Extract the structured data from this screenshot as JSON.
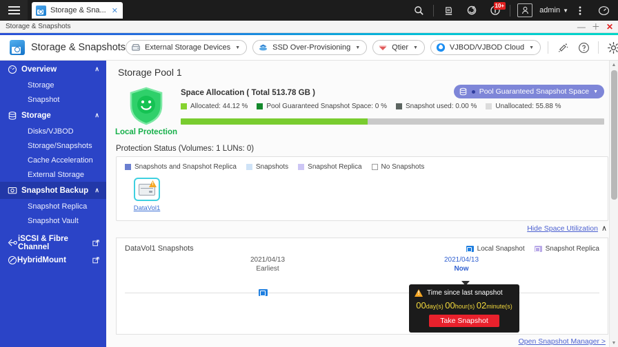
{
  "desktop": {
    "menu_icon": "hamburger-icon",
    "tab": {
      "title": "Storage & Sna...",
      "close": "✕"
    },
    "icons": [
      {
        "name": "search-icon"
      },
      {
        "name": "backup-station-icon"
      },
      {
        "name": "sync-icon"
      },
      {
        "name": "notification-icon",
        "badge": "10+"
      },
      {
        "name": "user-avatar-icon"
      },
      {
        "name": "more-options-icon"
      },
      {
        "name": "resource-monitor-icon"
      }
    ],
    "user": "admin",
    "user_caret": "▼"
  },
  "window": {
    "title": "Storage & Snapshots",
    "minimize": "—",
    "maximize": "＋",
    "close": "✕"
  },
  "toolbar": {
    "app_name": "Storage & Snapshots",
    "buttons": [
      {
        "label": "External Storage Devices",
        "icon": "external-storage-icon",
        "caret": "▼"
      },
      {
        "label": "SSD Over-Provisioning",
        "icon": "ssd-icon",
        "caret": "▼"
      },
      {
        "label": "Qtier",
        "icon": "qtier-icon",
        "caret": "▼"
      },
      {
        "label": "VJBOD/VJBOD Cloud",
        "icon": "vjbod-icon",
        "caret": "▼"
      }
    ],
    "tools": [
      {
        "name": "scan-icon"
      },
      {
        "name": "help-icon"
      },
      {
        "name": "settings-gear-icon"
      }
    ]
  },
  "sidebar": {
    "groups": [
      {
        "label": "Overview",
        "icon": "overview-icon",
        "chevron": "∧",
        "items": [
          {
            "label": "Storage"
          },
          {
            "label": "Snapshot"
          }
        ]
      },
      {
        "label": "Storage",
        "icon": "storage-icon",
        "chevron": "∧",
        "items": [
          {
            "label": "Disks/VJBOD"
          },
          {
            "label": "Storage/Snapshots"
          },
          {
            "label": "Cache Acceleration"
          },
          {
            "label": "External Storage"
          }
        ]
      },
      {
        "label": "Snapshot Backup",
        "icon": "snapshot-backup-icon",
        "chevron": "∧",
        "selected": true,
        "items": [
          {
            "label": "Snapshot Replica"
          },
          {
            "label": "Snapshot Vault"
          }
        ]
      }
    ],
    "links": [
      {
        "label": "iSCSI & Fibre Channel",
        "icon": "iscsi-icon",
        "external": "↗"
      },
      {
        "label": "HybridMount",
        "icon": "hybridmount-icon",
        "external": "↗"
      }
    ]
  },
  "main": {
    "pool_title": "Storage Pool 1",
    "protection": {
      "label": "Local Protection",
      "icon": "shield-smiley-icon"
    },
    "space_allocation": {
      "title": "Space Allocation ( Total 513.78 GB )",
      "legend": [
        {
          "label": "Allocated: 44.12 %",
          "color": "#86d32f"
        },
        {
          "label": "Pool Guaranteed Snapshot Space: 0 %",
          "color": "#14892c"
        },
        {
          "label": "Snapshot used: 0.00 %",
          "color": "#5c6561"
        },
        {
          "label": "Unallocated: 55.88 %",
          "color": "#dcdcdc"
        }
      ],
      "bar": {
        "allocated_pct": 44.12,
        "unallocated_pct": 55.88
      },
      "guaranteed_button": {
        "label": "Pool Guaranteed Snapshot Space",
        "icon": "pool-db-icon",
        "caret": "▼"
      }
    },
    "protection_status": {
      "heading": "Protection Status (Volumes: 1 LUNs: 0)",
      "legend": [
        {
          "label": "Snapshots and Snapshot Replica",
          "color": "#6b7fd0",
          "filled": true
        },
        {
          "label": "Snapshots",
          "color": "#cfe3f7",
          "filled": true
        },
        {
          "label": "Snapshot Replica",
          "color": "#cdc6f5",
          "filled": true
        },
        {
          "label": "No Snapshots",
          "color": "#ffffff",
          "filled": false
        }
      ],
      "volume": {
        "name": "DataVol1",
        "icon": "volume-warning-icon"
      }
    },
    "hide_space_utilization": {
      "label": "Hide Space Utilization",
      "chevron": "∧"
    },
    "snapshots": {
      "title": "DataVol1 Snapshots",
      "legend": [
        {
          "label": "Local Snapshot",
          "color": "#1f7fe0"
        },
        {
          "label": "Snapshot Replica",
          "color": "#b9a9e8"
        }
      ],
      "earliest": {
        "date": "2021/04/13",
        "caption": "Earliest"
      },
      "now": {
        "date": "2021/04/13",
        "caption": "Now"
      },
      "marker_icon": "local-snapshot-marker-icon"
    },
    "tooltip": {
      "warn_icon": "warning-triangle-icon",
      "title": "Time since last snapshot",
      "days_value": "00",
      "days_unit": "day(s)",
      "hours_value": "00",
      "hours_unit": "hour(s)",
      "minutes_value": "02",
      "minutes_unit": "minute(s)",
      "button": "Take Snapshot"
    },
    "open_snapshot_manager": "Open Snapshot Manager >"
  },
  "scrollbar": {
    "up": "▲",
    "down": "▼"
  }
}
